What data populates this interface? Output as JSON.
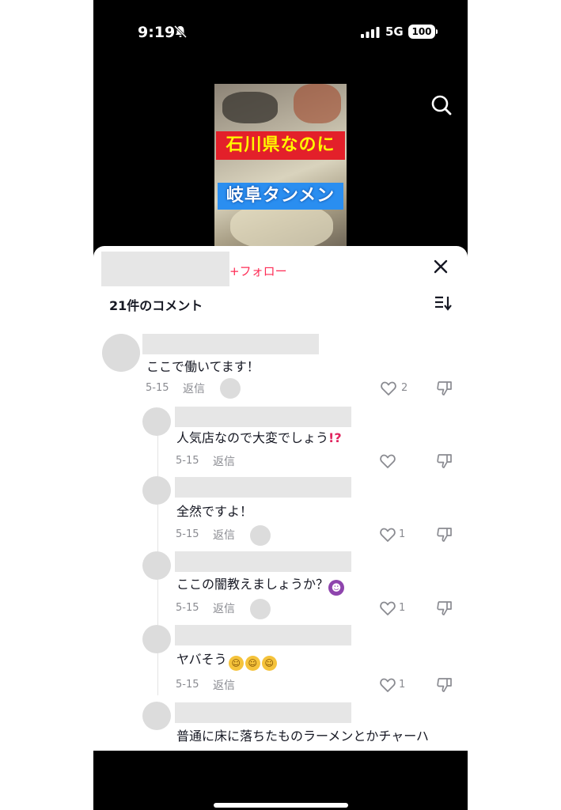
{
  "status_bar": {
    "time": "9:19",
    "network": "5G",
    "battery": "100"
  },
  "video": {
    "caption_line1": "石川県なのに",
    "caption_line2": "岐阜タンメン"
  },
  "sheet": {
    "follow_label": "+フォロー",
    "comment_count": "21件のコメント"
  },
  "comments": [
    {
      "text": "ここで働いてます！",
      "date": "5-15",
      "reply_label": "返信",
      "likes": "2"
    },
    {
      "text": "人気店なので大変でしょう",
      "emoji": "⁉️",
      "date": "5-15",
      "reply_label": "返信",
      "likes": ""
    },
    {
      "text": "全然ですよ！",
      "date": "5-15",
      "reply_label": "返信",
      "likes": "1"
    },
    {
      "text": "ここの闇教えましょうか？",
      "emoji": "devil",
      "date": "5-15",
      "reply_label": "返信",
      "likes": "1"
    },
    {
      "text": "ヤバそう",
      "emoji": "rolling-laughing x3",
      "date": "5-15",
      "reply_label": "返信",
      "likes": "1"
    },
    {
      "text": "普通に床に落ちたものラーメンとかチャーハ"
    }
  ],
  "colors": {
    "accent": "#fe2c55",
    "text": "#161823",
    "muted": "#8a8b91"
  }
}
